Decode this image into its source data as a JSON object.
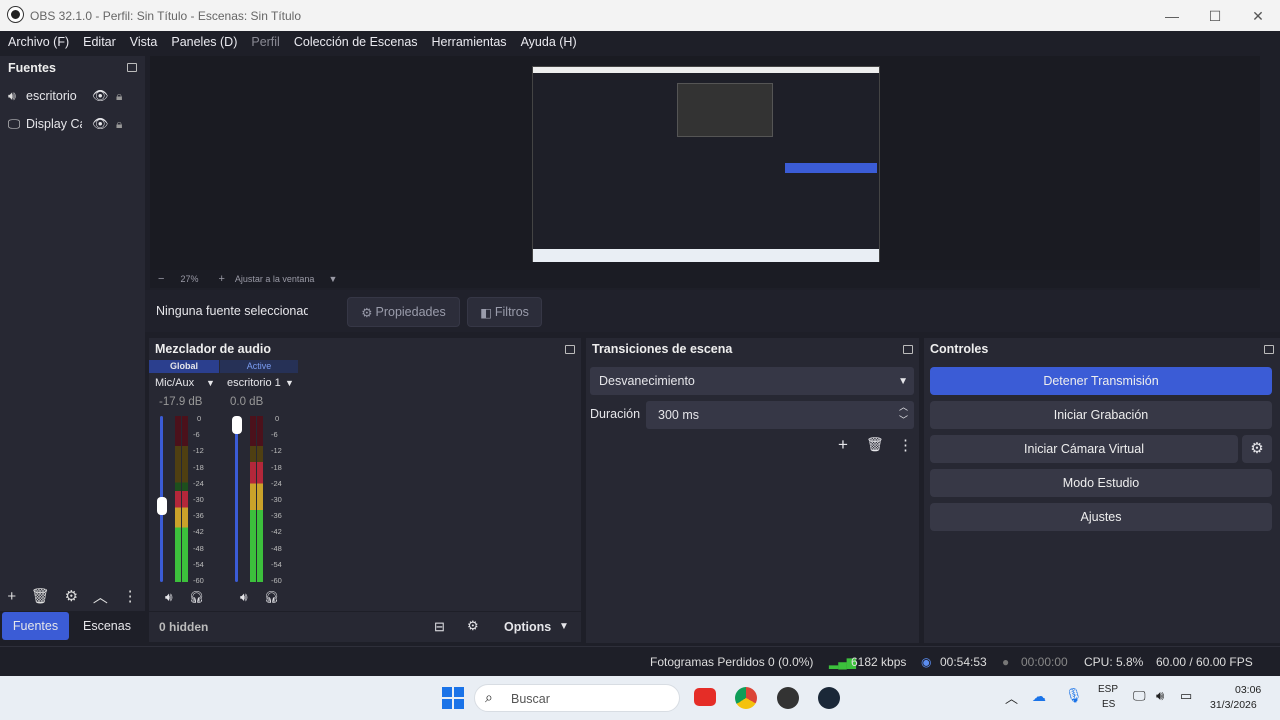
{
  "window": {
    "title": "OBS 32.1.0 - Perfil: Sin Título - Escenas: Sin Título",
    "minimize": "—",
    "maximize": "☐",
    "close": "✕"
  },
  "menu": [
    {
      "label": "Archivo (F)",
      "enabled": true
    },
    {
      "label": "Editar",
      "enabled": true
    },
    {
      "label": "Vista",
      "enabled": true
    },
    {
      "label": "Paneles (D)",
      "enabled": true
    },
    {
      "label": "Perfil",
      "enabled": false
    },
    {
      "label": "Colección de Escenas",
      "enabled": true
    },
    {
      "label": "Herramientas",
      "enabled": true
    },
    {
      "label": "Ayuda (H)",
      "enabled": true
    }
  ],
  "sources": {
    "title": "Fuentes",
    "items": [
      {
        "name": "escritorio",
        "icon": "speaker-icon"
      },
      {
        "name": "Display Capture",
        "icon": "monitor-icon"
      }
    ]
  },
  "zoom": {
    "minus": "−",
    "value": "27%",
    "plus": "+",
    "fit": "Ajustar a la ventana"
  },
  "props": {
    "none_selected": "Ninguna fuente seleccionada",
    "properties": "Propiedades",
    "filters": "Filtros"
  },
  "mixer": {
    "title": "Mezclador de audio",
    "channels": [
      {
        "tag": "Global",
        "name": "Mic/Aux",
        "db": "-17.9 dB",
        "level": 0.55,
        "volume": 0.45
      },
      {
        "tag": "Active",
        "name": "escritorio 1",
        "db": "0.0 dB",
        "level": 0.72,
        "volume": 1.0
      }
    ],
    "scale": [
      "0",
      "-6",
      "-12",
      "-18",
      "-24",
      "-30",
      "-36",
      "-42",
      "-48",
      "-54",
      "-60"
    ],
    "hidden": "0 hidden",
    "options": "Options"
  },
  "transitions": {
    "title": "Transiciones de escena",
    "selected": "Desvanecimiento",
    "duration_label": "Duración",
    "duration": "300 ms"
  },
  "controls": {
    "title": "Controles",
    "stream": "Detener Transmisión",
    "record": "Iniciar Grabación",
    "virtualcam": "Iniciar Cámara Virtual",
    "studio": "Modo Estudio",
    "settings": "Ajustes"
  },
  "tabs": {
    "sources": "Fuentes",
    "scenes": "Escenas"
  },
  "status": {
    "dropped": "Fotogramas Perdidos 0 (0.0%)",
    "bitrate": "6182 kbps",
    "stream_time": "00:54:53",
    "rec_time": "00:00:00",
    "cpu": "CPU: 5.8%",
    "fps": "60.00 / 60.00 FPS"
  },
  "taskbar": {
    "search": "Buscar",
    "lang1": "ESP",
    "lang2": "ES",
    "time": "03:06",
    "date": "31/3/2026"
  },
  "colors": {
    "accent": "#3b5cd6",
    "panel": "#272833",
    "bg": "#1e1f28"
  }
}
